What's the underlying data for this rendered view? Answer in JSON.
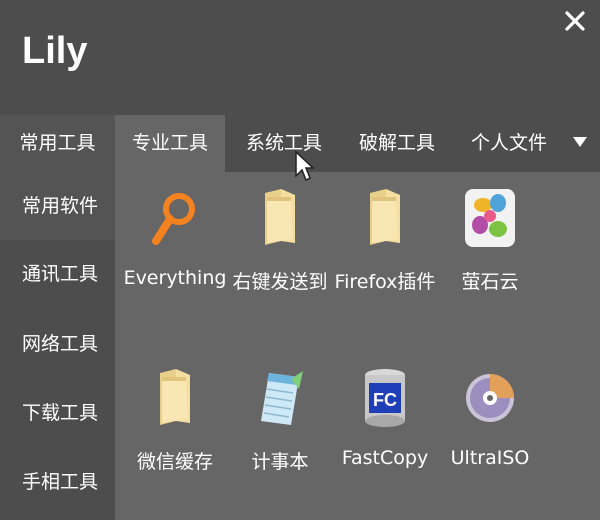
{
  "app": {
    "title": "Lily",
    "close_label": "X"
  },
  "tabs": [
    {
      "label": "常用工具"
    },
    {
      "label": "专业工具"
    },
    {
      "label": "系统工具"
    },
    {
      "label": "破解工具"
    },
    {
      "label": "个人文件"
    }
  ],
  "sidebar": {
    "items": [
      {
        "label": "常用软件"
      },
      {
        "label": "通讯工具"
      },
      {
        "label": "网络工具"
      },
      {
        "label": "下载工具"
      },
      {
        "label": "手相工具"
      }
    ]
  },
  "apps": [
    {
      "label": "Everything",
      "icon": "everything-icon"
    },
    {
      "label": "右键发送到",
      "icon": "folder-icon"
    },
    {
      "label": "Firefox插件",
      "icon": "folder-icon"
    },
    {
      "label": "萤石云",
      "icon": "ezviz-icon"
    },
    {
      "label": "微信缓存",
      "icon": "folder-icon"
    },
    {
      "label": "计事本",
      "icon": "notepad-icon"
    },
    {
      "label": "FastCopy",
      "icon": "fastcopy-icon"
    },
    {
      "label": "UltraISO",
      "icon": "ultraiso-icon"
    }
  ],
  "colors": {
    "background": "#4d4d4d",
    "active_tab": "#666666",
    "content_panel": "#666666",
    "active_sidebar": "#545454",
    "accent_orange": "#f58220"
  }
}
